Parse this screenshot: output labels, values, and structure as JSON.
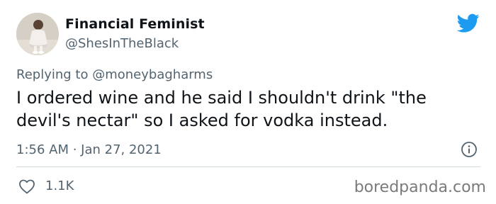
{
  "tweet": {
    "author_name": "Financial Feminist",
    "author_handle": "@ShesInTheBlack",
    "replying_label": "Replying to",
    "replying_mention": "@moneybagharms",
    "text": "I ordered wine and he said I shouldn't drink \"the devil's nectar\" so I asked for vodka instead.",
    "timestamp": "1:56 AM · Jan 27, 2021",
    "like_count": "1.1K"
  },
  "icons": {
    "brand": "twitter-bird-icon",
    "info": "info-icon",
    "like": "heart-icon"
  },
  "colors": {
    "twitter_blue": "#1d9bf0",
    "secondary_text": "#536471",
    "primary_text": "#0f1419",
    "divider": "#cfd9de"
  },
  "watermark": "boredpanda.com"
}
